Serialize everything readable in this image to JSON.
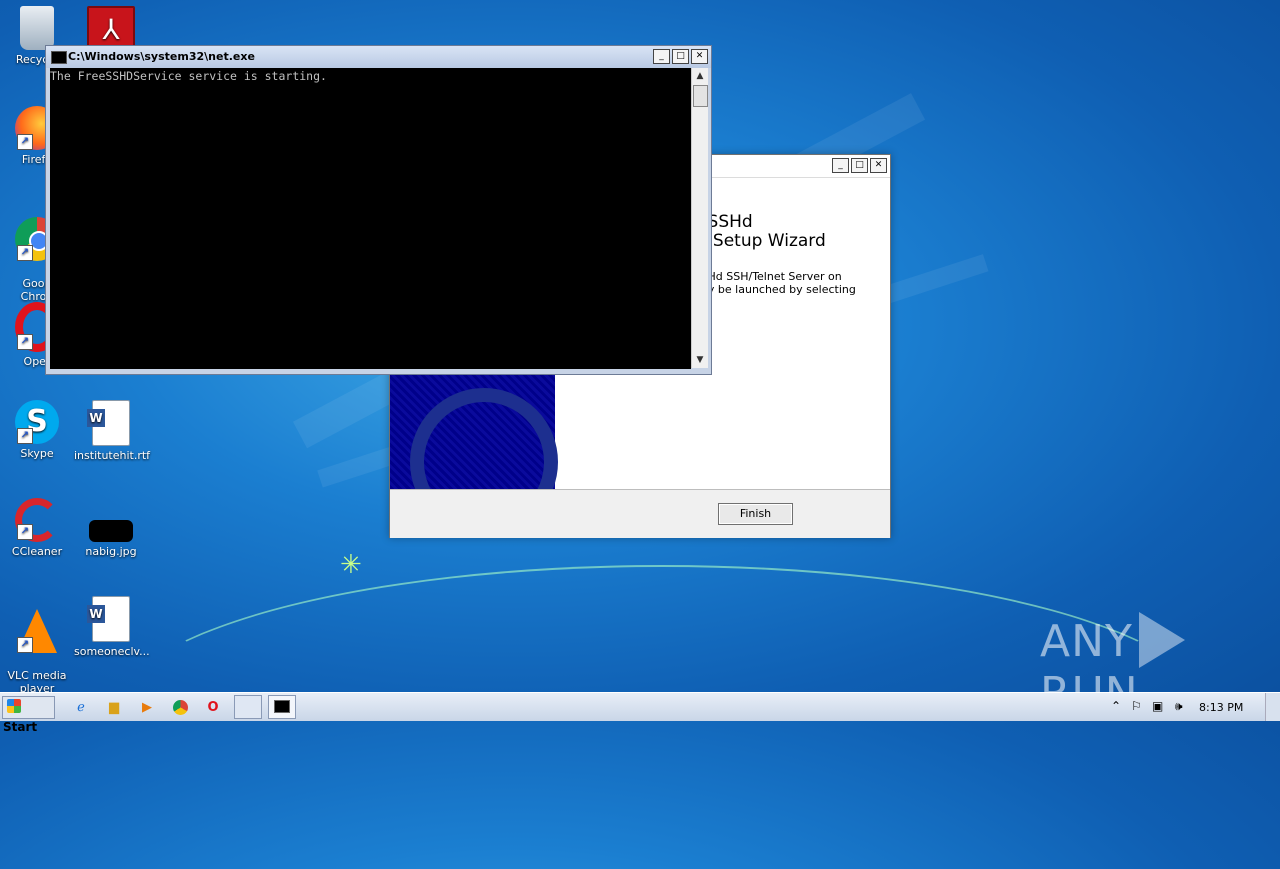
{
  "desktop": {
    "icons": [
      {
        "label": "Recycle"
      },
      {
        "label": ""
      },
      {
        "label": "Firefo"
      },
      {
        "label": "Goog\nChron"
      },
      {
        "label": "Oper"
      },
      {
        "label": "Skype"
      },
      {
        "label": "institutehit.rtf"
      },
      {
        "label": "CCleaner"
      },
      {
        "label": "nabig.jpg"
      },
      {
        "label": "VLC media\nplayer"
      },
      {
        "label": "someoneclv..."
      }
    ]
  },
  "console": {
    "title": "C:\\Windows\\system32\\net.exe",
    "output": "The FreeSSHDService service is starting."
  },
  "wizard": {
    "heading_line1": "reeSSHd",
    "heading_line2": "ver Setup Wizard",
    "desc_line1": "eeSSHd SSH/Telnet Server on",
    "desc_line2": "n may be launched by selecting",
    "finish_label": "Finish"
  },
  "taskbar": {
    "start_label": "Start",
    "clock": "8:13 PM"
  },
  "watermark": {
    "left": "ANY",
    "right": "RUN"
  },
  "colors": {
    "desktop_bg": "#1b7fd1",
    "console_bg": "#000000",
    "console_text": "#c0c0c0",
    "wizard_side": "#00008a"
  }
}
